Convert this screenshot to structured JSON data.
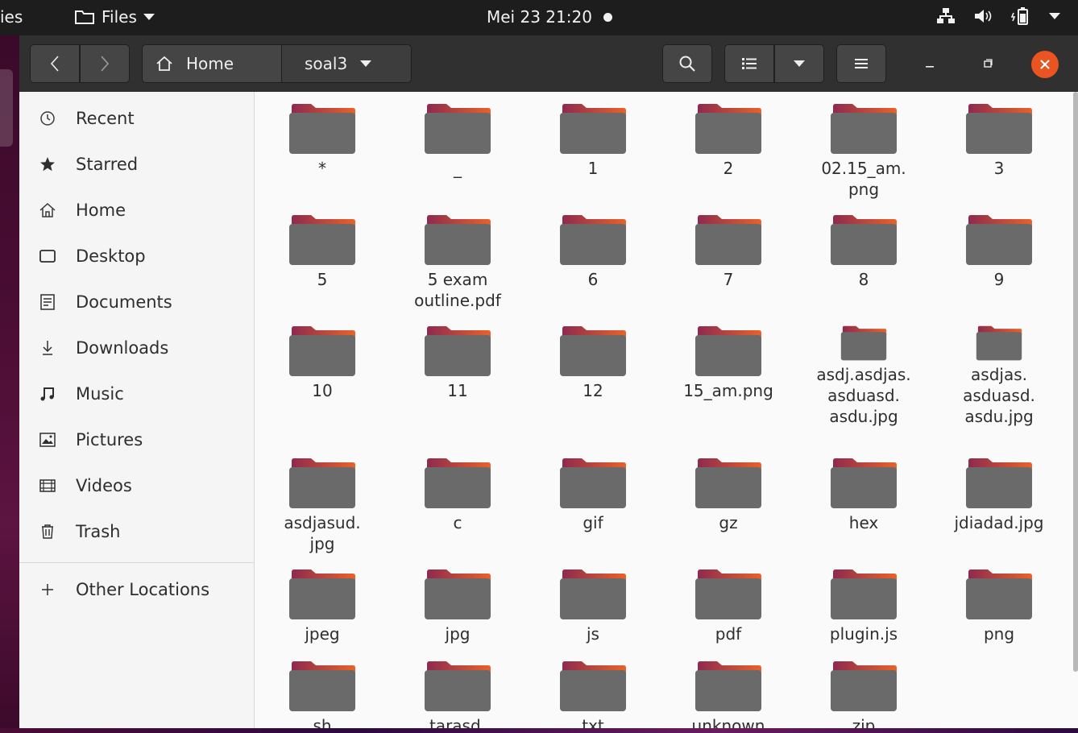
{
  "top_panel": {
    "activities": "ies",
    "app_menu": "Files",
    "clock": "Mei 23  21:20"
  },
  "headerbar": {
    "breadcrumb_home": "Home",
    "breadcrumb_current": "soal3"
  },
  "sidebar": {
    "items": [
      {
        "label": "Recent",
        "icon": "clock-icon"
      },
      {
        "label": "Starred",
        "icon": "star-icon"
      },
      {
        "label": "Home",
        "icon": "home-icon"
      },
      {
        "label": "Desktop",
        "icon": "desktop-icon"
      },
      {
        "label": "Documents",
        "icon": "documents-icon"
      },
      {
        "label": "Downloads",
        "icon": "download-icon"
      },
      {
        "label": "Music",
        "icon": "music-icon"
      },
      {
        "label": "Pictures",
        "icon": "pictures-icon"
      },
      {
        "label": "Videos",
        "icon": "videos-icon"
      },
      {
        "label": "Trash",
        "icon": "trash-icon"
      }
    ],
    "other_locations": "Other Locations"
  },
  "files": [
    "*",
    "_",
    "1",
    "2",
    "02.15_am.\npng",
    "3",
    "5",
    "5 exam\noutline.pdf",
    "6",
    "7",
    "8",
    "9",
    "10",
    "11",
    "12",
    "15_am.png",
    "asdj.asdjas.\nasduasd.\nasdu.jpg",
    "asdjas.\nasduasd.\nasdu.jpg",
    "asdjasud.\njpg",
    "c",
    "gif",
    "gz",
    "hex",
    "jdiadad.jpg",
    "jpeg",
    "jpg",
    "js",
    "pdf",
    "plugin.js",
    "png",
    "sh",
    "tarasd.",
    "txt",
    "unknown",
    "zip"
  ],
  "colors": {
    "accent": "#e95420",
    "folder_tab": "#8e2a4e",
    "folder_body": "#6a6a6a"
  }
}
